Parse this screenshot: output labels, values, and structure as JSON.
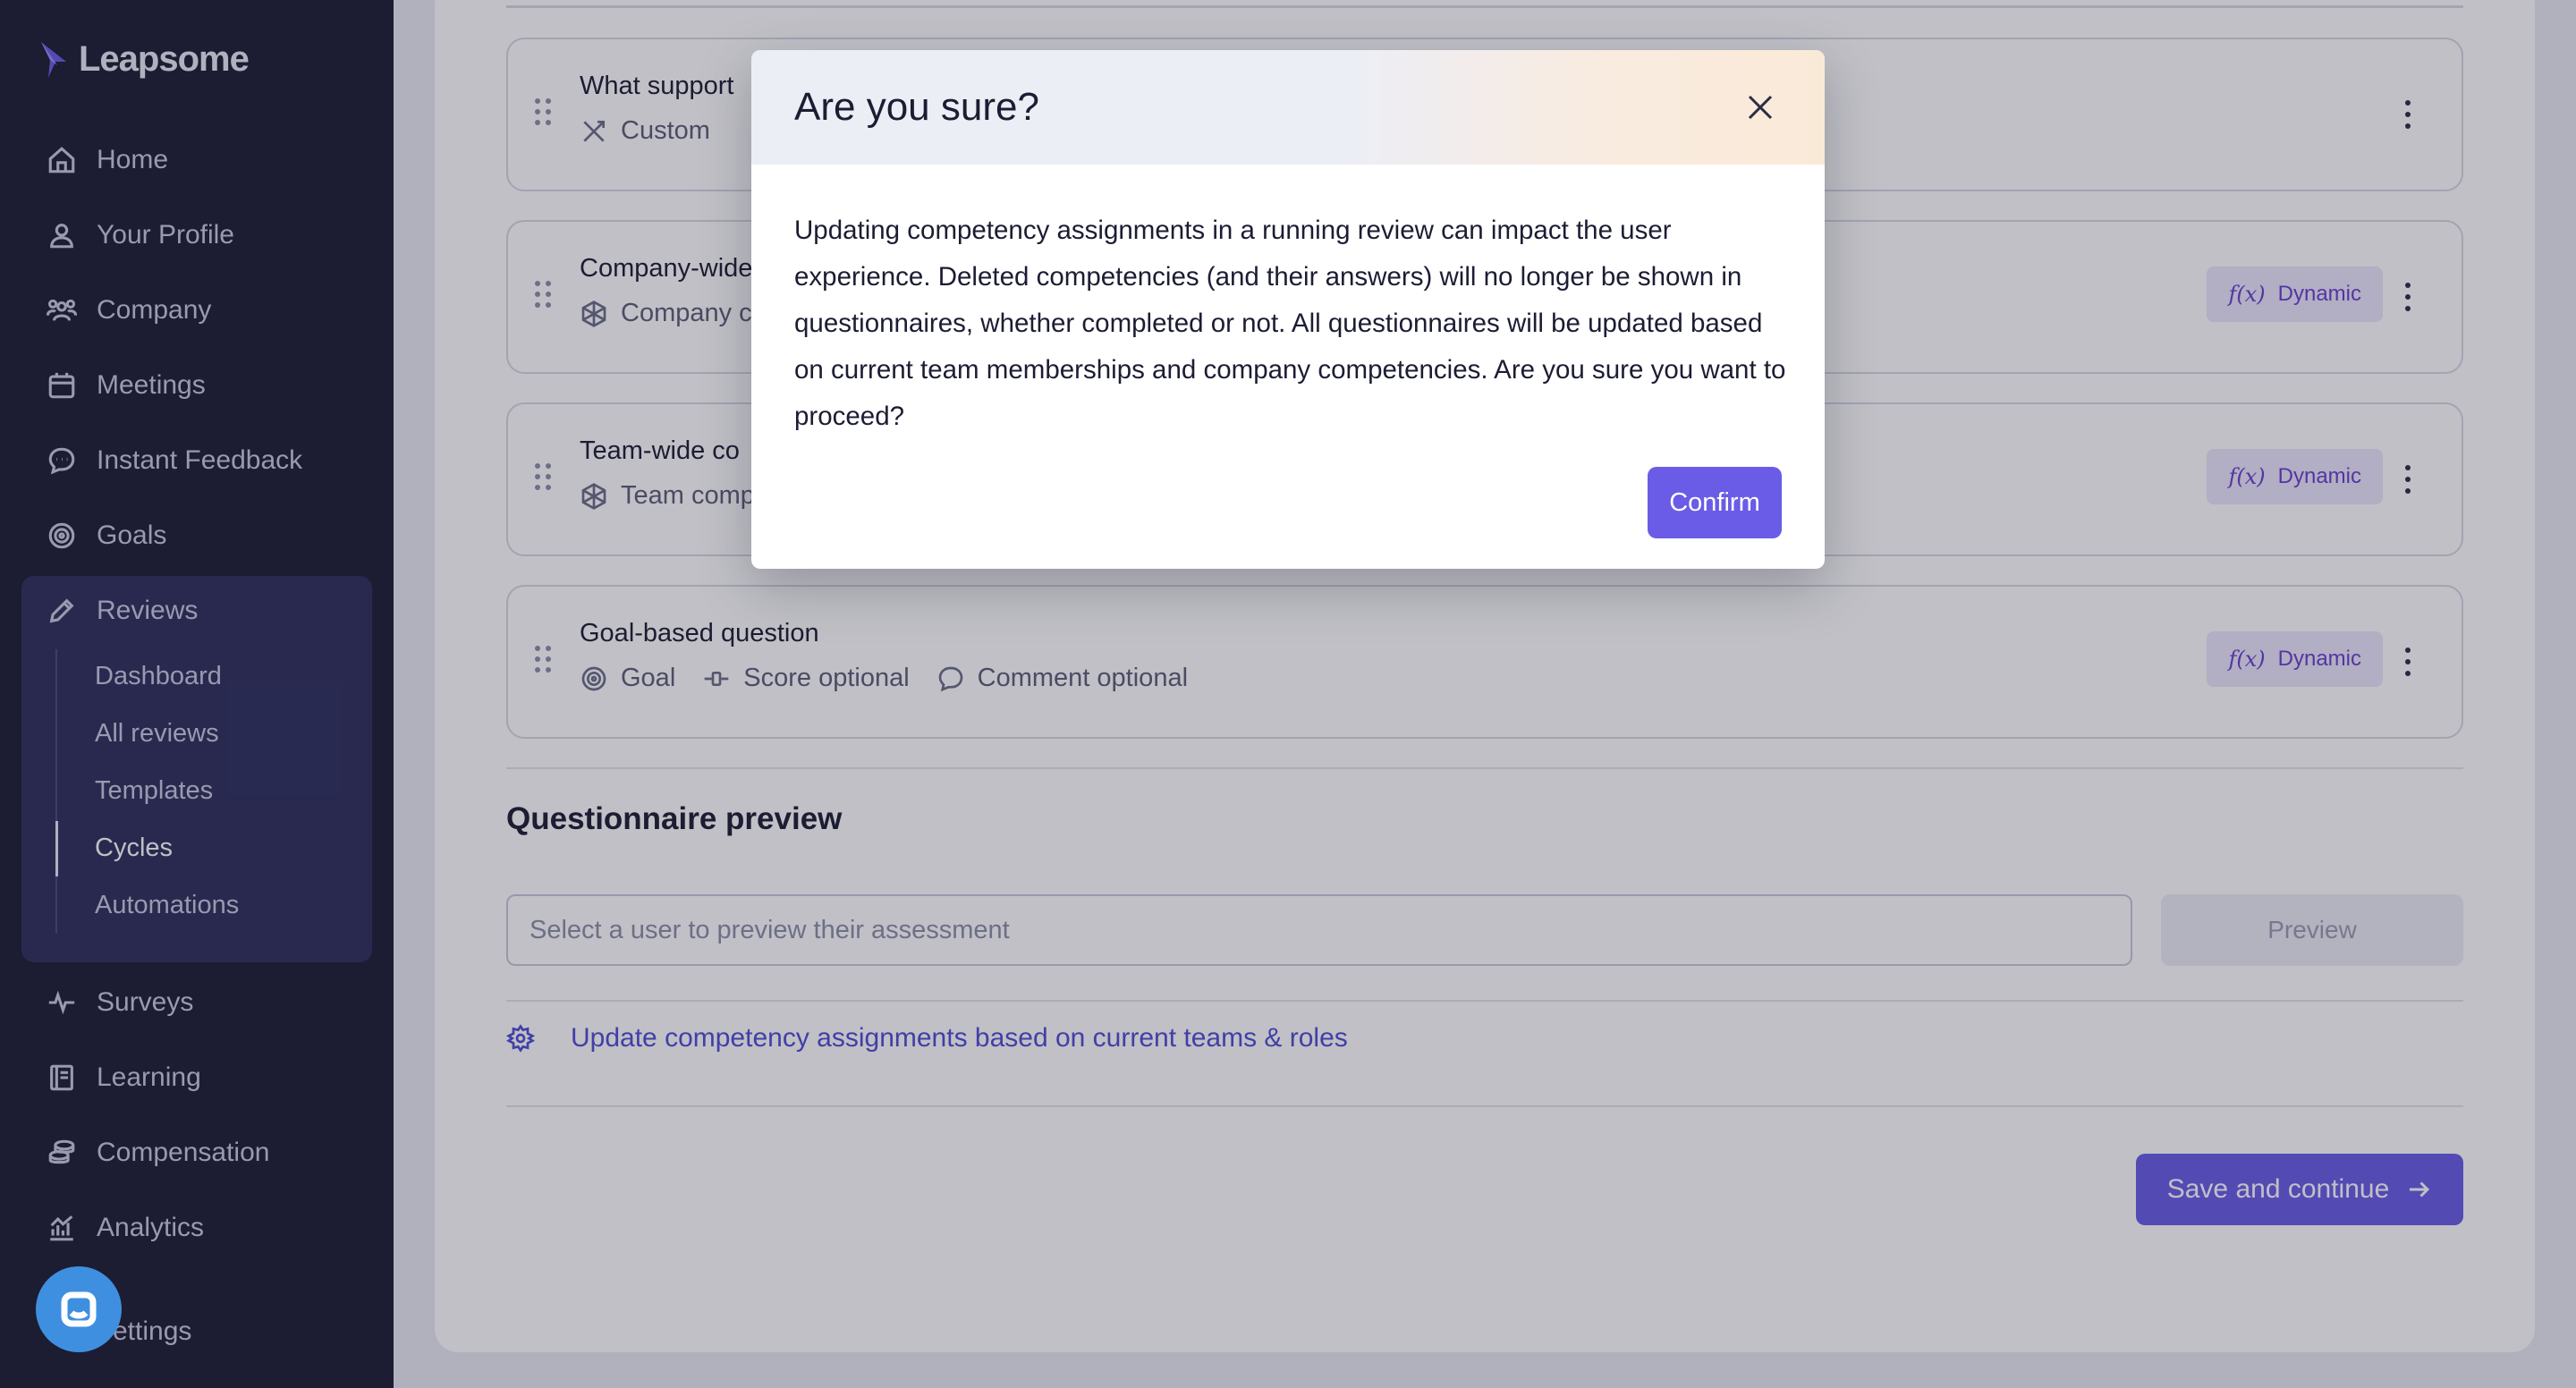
{
  "app": {
    "name": "Leapsome"
  },
  "sidebar": {
    "items": [
      {
        "label": "Home",
        "icon": "home-icon"
      },
      {
        "label": "Your Profile",
        "icon": "user-icon"
      },
      {
        "label": "Company",
        "icon": "users-icon"
      },
      {
        "label": "Meetings",
        "icon": "calendar-icon"
      },
      {
        "label": "Instant Feedback",
        "icon": "chat-bubble-icon"
      },
      {
        "label": "Goals",
        "icon": "target-icon"
      },
      {
        "label": "Reviews",
        "icon": "pencil-icon"
      },
      {
        "label": "Surveys",
        "icon": "pulse-icon"
      },
      {
        "label": "Learning",
        "icon": "book-icon"
      },
      {
        "label": "Compensation",
        "icon": "coins-icon"
      },
      {
        "label": "Analytics",
        "icon": "chart-icon"
      },
      {
        "label": "Settings",
        "icon": "gear-icon"
      }
    ],
    "reviews_sub": [
      "Dashboard",
      "All reviews",
      "Templates",
      "Cycles",
      "Automations"
    ],
    "settings_partial": "ettings"
  },
  "questions": [
    {
      "title": "What support",
      "meta": [
        "Custom"
      ],
      "badge": null
    },
    {
      "title": "Company-wide",
      "meta": [
        "Company c"
      ],
      "badge": "Dynamic"
    },
    {
      "title": "Team-wide co",
      "meta": [
        "Team comp"
      ],
      "badge": "Dynamic"
    },
    {
      "title": "Goal-based question",
      "meta": [
        "Goal",
        "Score optional",
        "Comment optional"
      ],
      "badge": "Dynamic"
    }
  ],
  "badge_fx": "f(x)",
  "preview": {
    "title": "Questionnaire preview",
    "placeholder": "Select a user to preview their assessment",
    "button": "Preview"
  },
  "update_link": "Update competency assignments based on current teams & roles",
  "save_button": "Save and continue",
  "modal": {
    "title": "Are you sure?",
    "body": "Updating competency assignments in a running review can impact the user experience. Deleted competencies (and their answers) will no longer be shown in questionnaires, whether completed or not. All questionnaires will be updated based on current team memberships and company competencies. Are you sure you want to proceed?",
    "confirm": "Confirm"
  },
  "colors": {
    "sidebar_bg": "#1c1d33",
    "accent": "#6a5ce6",
    "badge_bg": "#ece6fb",
    "badge_text": "#6a3fd0",
    "link": "#4f4dd4"
  }
}
